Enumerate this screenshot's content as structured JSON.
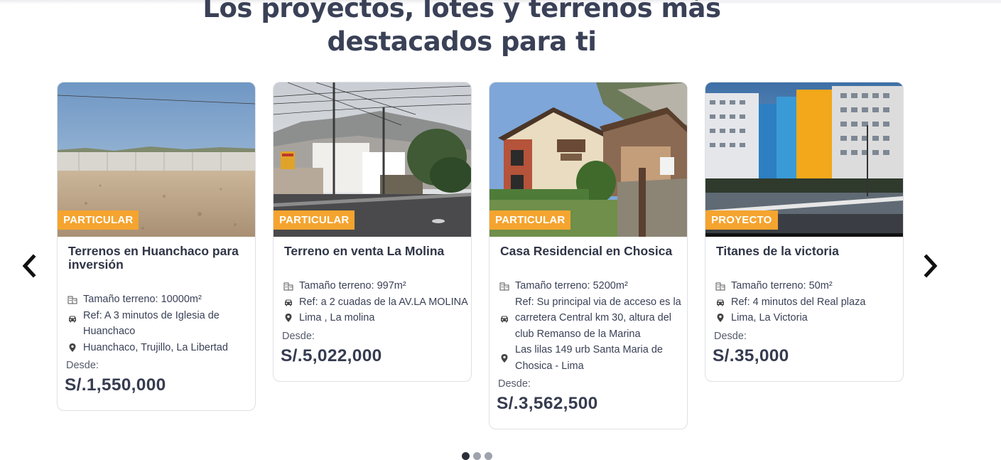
{
  "section": {
    "title": "Los proyectos, lotes y terrenos más destacados para ti"
  },
  "carousel": {
    "prev_icon": "chevron-left-icon",
    "next_icon": "chevron-right-icon",
    "dots_total": 3,
    "dots_active": 1
  },
  "cards": [
    {
      "badge": "PARTICULAR",
      "title": "Terrenos en Huanchaco para inversión",
      "size": "Tamaño terreno: 10000m²",
      "ref": "Ref: A 3 minutos de Iglesia de Huanchaco",
      "location": "Huanchaco, Trujillo, La Libertad",
      "from_label": "Desde:",
      "price": "S/.1,550,000"
    },
    {
      "badge": "PARTICULAR",
      "title": "Terreno en venta La Molina",
      "size": "Tamaño terreno: 997m²",
      "ref": "Ref: a 2 cuadas de la AV.LA MOLINA",
      "location": "Lima , La molina",
      "from_label": "Desde:",
      "price": "S/.5,022,000"
    },
    {
      "badge": "PARTICULAR",
      "title": "Casa Residencial en Chosica",
      "size": "Tamaño terreno: 5200m²",
      "ref": "Ref: Su principal via de acceso es la carretera Central km 30, altura del club Remanso de la Marina",
      "location": "Las lilas 149 urb Santa Maria de Chosica - Lima",
      "from_label": "Desde:",
      "price": "S/.3,562,500"
    },
    {
      "badge": "PROYECTO",
      "title": "Titanes de la victoria",
      "size": "Tamaño terreno: 50m²",
      "ref": "Ref: 4 minutos del Real plaza",
      "location": "Lima, La Victoria",
      "from_label": "Desde:",
      "price": "S/.35,000"
    }
  ],
  "colors": {
    "badge": "#f5a42f",
    "heading": "#3a4157",
    "border": "#dfe0e4"
  },
  "icons": {
    "size": "building-icon",
    "ref": "car-icon",
    "location": "map-pin-icon"
  }
}
